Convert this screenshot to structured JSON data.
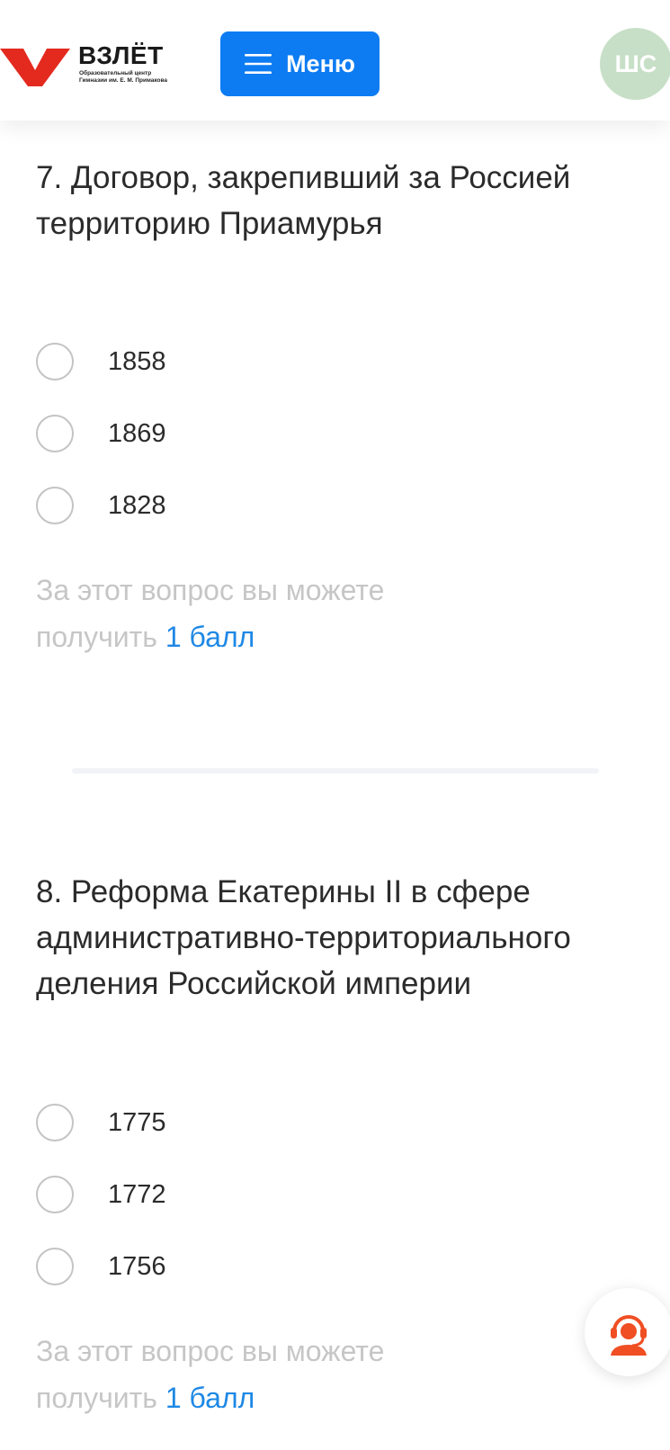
{
  "header": {
    "logo_title": "ВЗЛЁТ",
    "logo_subtitle_line1": "Образовательный центр",
    "logo_subtitle_line2": "Гимназии им. Е. М. Примакова",
    "menu_label": "Меню",
    "avatar_initials": "ШС",
    "colors": {
      "brand_red": "#e42a1f",
      "menu_blue": "#0d7cf2",
      "avatar_bg": "#c7dfc6"
    }
  },
  "questions": [
    {
      "title": "7. Договор, закрепивший за Россией территорию Приамурья",
      "options": [
        "1858",
        "1869",
        "1828"
      ],
      "points_prefix": "За этот вопрос вы можете получить",
      "points_value": "1 балл"
    },
    {
      "title": "8. Реформа Екатерины II в сфере административно-территориального деления Российской империи",
      "options": [
        "1775",
        "1772",
        "1756"
      ],
      "points_prefix": "За этот вопрос вы можете получить",
      "points_value": "1 балл"
    }
  ],
  "support": {
    "icon": "support-operator-icon",
    "color": "#f04e23"
  }
}
